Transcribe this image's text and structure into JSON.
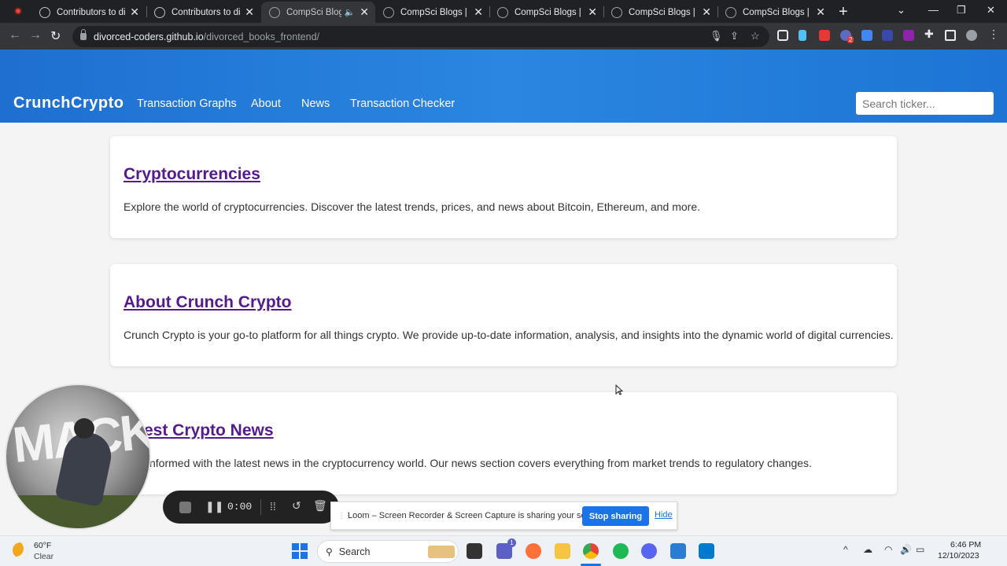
{
  "browser": {
    "tabs": [
      {
        "title": "Contributors to divo"
      },
      {
        "title": "Contributors to divo"
      },
      {
        "title": "CompSci Blogs"
      },
      {
        "title": "CompSci Blogs | Au"
      },
      {
        "title": "CompSci Blogs | Au"
      },
      {
        "title": "CompSci Blogs | Au"
      },
      {
        "title": "CompSci Blogs | Au"
      }
    ],
    "url_host": "divorced-coders.github.io",
    "url_path": "/divorced_books_frontend/",
    "ext_badge": "2"
  },
  "site": {
    "brand": "CrunchCrypto",
    "nav": [
      "Transaction Graphs",
      "About",
      "News",
      "Transaction Checker"
    ],
    "search_placeholder": "Search ticker...",
    "header_color": "#2a86e0",
    "link_color": "#551a8b"
  },
  "sections": [
    {
      "title": "Cryptocurrencies",
      "text": "Explore the world of cryptocurrencies. Discover the latest trends, prices, and news about Bitcoin, Ethereum, and more."
    },
    {
      "title": "About Crunch Crypto",
      "text": "Crunch Crypto is your go-to platform for all things crypto. We provide up-to-date information, analysis, and insights into the dynamic world of digital currencies."
    },
    {
      "title": "test Crypto News",
      "text": "nformed with the latest news in the cryptocurrency world. Our news section covers everything from market trends to regulatory changes."
    }
  ],
  "loom": {
    "camera_text": "MACK",
    "timer": "0:00",
    "share_text": "Loom – Screen Recorder & Screen Capture is sharing your screen.",
    "stop_label": "Stop sharing",
    "hide_label": "Hide"
  },
  "taskbar": {
    "temp": "60°F",
    "condition": "Clear",
    "search_label": "Search",
    "time": "6:46 PM",
    "date": "12/10/2023",
    "teams_badge": "1"
  }
}
